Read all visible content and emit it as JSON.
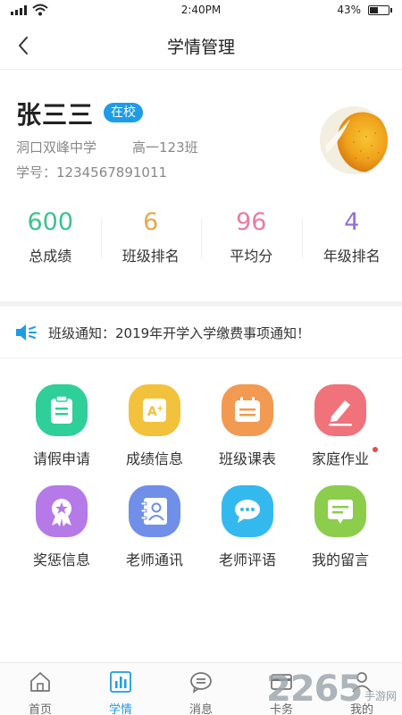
{
  "status_bar": {
    "time": "2:40PM",
    "battery": "43%"
  },
  "nav": {
    "title": "学情管理"
  },
  "profile": {
    "name": "张三三",
    "status": "在校",
    "school": "洞口双峰中学",
    "class": "高一123班",
    "student_id": "学号：1234567891011"
  },
  "stats": [
    {
      "value": "600",
      "label": "总成绩",
      "color": "#3cc38e"
    },
    {
      "value": "6",
      "label": "班级排名",
      "color": "#e8a94a"
    },
    {
      "value": "96",
      "label": "平均分",
      "color": "#e97aa5"
    },
    {
      "value": "4",
      "label": "年级排名",
      "color": "#8f6fd9"
    }
  ],
  "notice": {
    "text": "班级通知：2019年开学入学缴费事项通知！"
  },
  "grid": [
    {
      "label": "请假申请",
      "icon": "leave-request-icon",
      "color": "#2fcf9a"
    },
    {
      "label": "成绩信息",
      "icon": "grade-info-icon",
      "color": "#f2c23c"
    },
    {
      "label": "班级课表",
      "icon": "schedule-icon",
      "color": "#f29a52"
    },
    {
      "label": "家庭作业",
      "icon": "homework-icon",
      "color": "#f0727b"
    },
    {
      "label": "奖惩信息",
      "icon": "award-icon",
      "color": "#b67ae8"
    },
    {
      "label": "老师通讯",
      "icon": "contacts-icon",
      "color": "#6f8fe8"
    },
    {
      "label": "老师评语",
      "icon": "comment-icon",
      "color": "#34b9ef"
    },
    {
      "label": "我的留言",
      "icon": "message-icon",
      "color": "#8ccd4c"
    }
  ],
  "tabs": [
    {
      "label": "首页",
      "icon": "home-icon"
    },
    {
      "label": "学情",
      "icon": "stats-icon"
    },
    {
      "label": "消息",
      "icon": "chat-icon"
    },
    {
      "label": "卡务",
      "icon": "card-icon"
    },
    {
      "label": "我的",
      "icon": "user-icon"
    }
  ],
  "watermark": {
    "big": "2265",
    "small": "手游网"
  },
  "colors": {
    "accent": "#1e9ce6",
    "notice_dot": "#e94c4c"
  }
}
